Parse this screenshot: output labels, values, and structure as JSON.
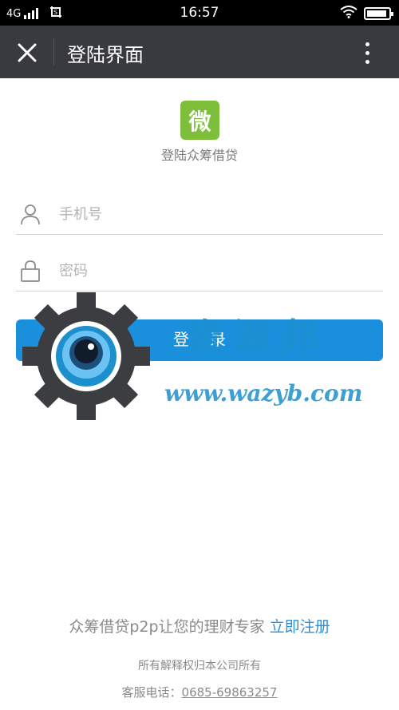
{
  "status_bar": {
    "network": "4G",
    "time": "16:57",
    "battery_level": 0.92,
    "icons": [
      "signal-icon",
      "screenshot-icon",
      "wifi-icon",
      "battery-icon"
    ]
  },
  "title_bar": {
    "title": "登陆界面",
    "close_icon": "close-icon",
    "more_icon": "more-vertical-icon"
  },
  "brand": {
    "logo_text": "微",
    "logo_color": "#7dbf3a",
    "app_name": "登陆众筹借贷"
  },
  "form": {
    "phone_placeholder": "手机号",
    "phone_value": "",
    "password_placeholder": "密码",
    "password_value": "",
    "login_label": "登录",
    "button_color": "#1a8fdc"
  },
  "watermark": {
    "text": "资源邦",
    "url": "www.wazyb.com",
    "icon": "gear-eye-icon"
  },
  "footer": {
    "slogan": "众筹借贷p2p让您的理财专家",
    "register_label": "立即注册",
    "rights": "所有解释权归本公司所有",
    "service_label": "客服电话：",
    "service_phone": "0685-69863257"
  }
}
